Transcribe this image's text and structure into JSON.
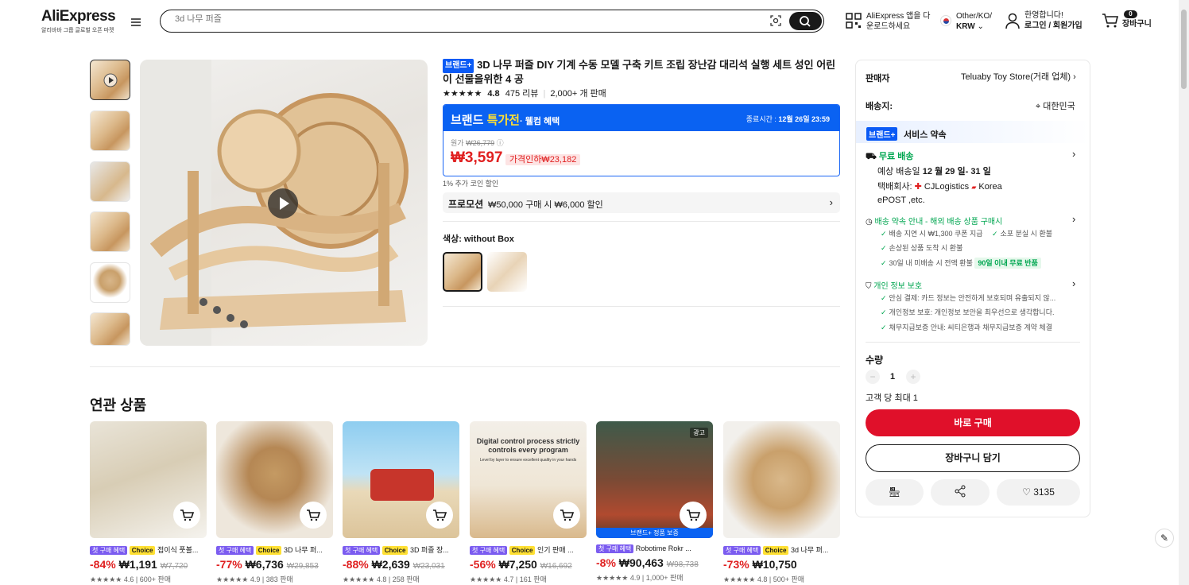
{
  "header": {
    "logo": "AliExpress",
    "logo_sub": "알리바바 그룹 글로벌 오픈 마켓",
    "search_placeholder": "3d 나무 퍼즐",
    "app_line1": "AliExpress 앱을 다",
    "app_line2": "운로드하세요",
    "region_line1": "Other/KO/",
    "region_line2": "KRW",
    "account_line1": "한영합니다!",
    "account_line2": "로그인 / 회원가입",
    "cart_count": "0",
    "cart_label": "장바구니"
  },
  "product": {
    "brand_badge": "브랜드+",
    "title": "3D 나무 퍼즐 DIY 기계 수동 모델 구축 키트 조립 장난감 대리석 실행 세트 성인 어린이 선물을위한 4 공",
    "rating": "4.8",
    "reviews": "475 리뷰",
    "sold": "2,000+ 개 판매",
    "promo_head1": "브랜드 ",
    "promo_head2": "특가전",
    "promo_head3": "· 웰컴 혜택",
    "promo_end_label": "종료시간 : ",
    "promo_end_value": "12월 26일 23:59",
    "orig_label": "원가",
    "orig_price": "₩26,779",
    "price": "₩3,597",
    "price_drop": "가격인하₩23,182",
    "coin": "1% 추가 코인 할인",
    "coupon_label": "프로모션",
    "coupon_text": "₩50,000 구매 시 ₩6,000 할인",
    "color_label": "색상: without Box"
  },
  "panel": {
    "seller_label": "판매자",
    "seller_value": "Teluaby Toy Store(거래 업체)",
    "ship_label": "배송지:",
    "ship_value": "대한민국",
    "service_badge": "브랜드+",
    "service_title": "서비스 약속",
    "free_ship": "무료 배송",
    "eta_pre": "예상 배송일 ",
    "eta_date": "12 월 29 일- 31 일",
    "carrier_pre": "택배회사:",
    "carrier1": "CJLogistics",
    "carrier2": "Korea",
    "carrier3": "ePOST ,etc.",
    "guarantee_title": "배송 약속 안내 - 해외 배송 상품 구매시",
    "g1": "배송 지연 시 ₩1,300 쿠폰 지급",
    "g2": "소포 분실 시 환불",
    "g3": "손상된 상품 도착 시 환불",
    "g4": "30일 내 미배송 시 전액 환불",
    "g4_badge": "90일 이내 무료 반품",
    "privacy_title": "개인 정보 보호",
    "p1": "안심 결제: 카드 정보는 안전하게 보호되며 유출되지 않...",
    "p2": "개인정보 보호: 개인정보 보안을 최우선으로 생각합니다.",
    "p3": "채무지급보증 안내: 씨티은행과 채무지급보증 계약 체결",
    "qty_label": "수량",
    "qty_value": "1",
    "qty_limit": "고객 당 최대 1",
    "buy_now": "바로 구매",
    "add_cart": "장바구니 담기",
    "wish_count": "3135"
  },
  "related": {
    "title": "연관 상품",
    "items": [
      {
        "tag1": "첫 구매 혜택",
        "tag2": "Choice",
        "name": "접이식 풋볼...",
        "pct": "-84%",
        "price": "₩1,191",
        "orig": "₩7,720",
        "stats": "4.6 | 600+ 판매"
      },
      {
        "tag1": "첫 구매 혜택",
        "tag2": "Choice",
        "name": "3D 나무 퍼...",
        "pct": "-77%",
        "price": "₩6,736",
        "orig": "₩29,853",
        "stats": "4.9 | 383 판매"
      },
      {
        "tag1": "첫 구매 혜택",
        "tag2": "Choice",
        "name": "3D 퍼즐 장...",
        "pct": "-88%",
        "price": "₩2,639",
        "orig": "₩23,031",
        "stats": "4.8 | 258 판매"
      },
      {
        "tag1": "첫 구매 혜택",
        "tag2": "Choice",
        "name": "인기 판매 ...",
        "pct": "-56%",
        "price": "₩7,250",
        "orig": "₩16,692",
        "stats": "4.7 | 161 판매"
      },
      {
        "tag1": "첫 구매 혜택",
        "tag2": "",
        "name": "Robotime Rokr ...",
        "pct": "-8%",
        "price": "₩90,463",
        "orig": "₩98,738",
        "stats": "4.9 | 1,000+ 판매"
      },
      {
        "tag1": "첫 구매 혜택",
        "tag2": "Choice",
        "name": "3d 나무 퍼...",
        "pct": "-73%",
        "price": "₩10,750",
        "orig": "",
        "stats": "4.8 | 500+ 판매"
      }
    ],
    "ad_label": "광고",
    "brand_strip": "브랜드+ 정품 보증",
    "img2_text1": "Digital control process strictly",
    "img2_text2": "controls every program",
    "img2_text3": "Level by layer to ensure excellent quality in your hands"
  }
}
